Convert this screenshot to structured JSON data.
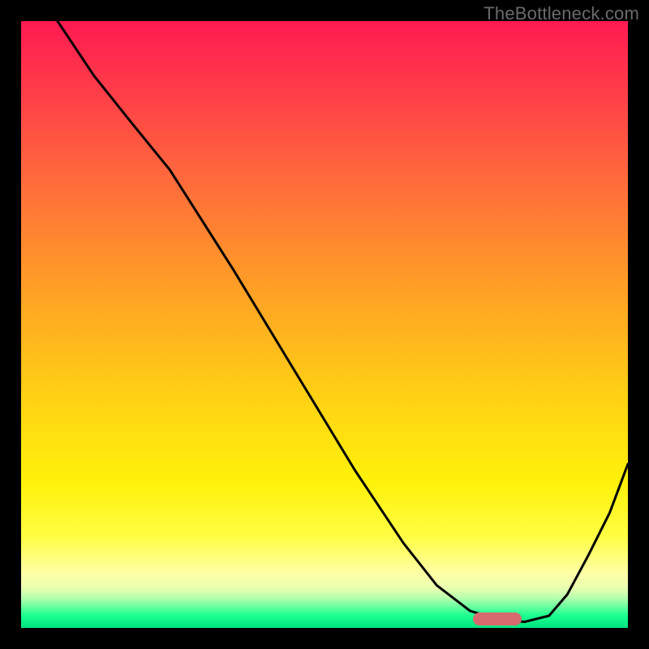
{
  "credit_text": "TheBottleneck.com",
  "chart_data": {
    "type": "line",
    "title": "",
    "xlabel": "",
    "ylabel": "",
    "xlim": [
      0,
      100
    ],
    "ylim": [
      0,
      100
    ],
    "series": [
      {
        "name": "curve",
        "x": [
          6,
          12,
          18,
          24.5,
          35,
          45,
          55,
          63,
          68.5,
          74,
          79,
          83,
          87,
          90,
          93.5,
          97,
          100
        ],
        "values": [
          100,
          91,
          83.5,
          75.5,
          59,
          42.5,
          26,
          14,
          7,
          2.8,
          1.3,
          1.0,
          2.0,
          5.5,
          12,
          19,
          27
        ]
      }
    ],
    "marker": {
      "x_center": 78.5,
      "y": 1.5,
      "width_pct": 8
    },
    "gradient": {
      "direction": "top-to-bottom",
      "stops": [
        {
          "pos": 0.0,
          "color": "#ff1a52"
        },
        {
          "pos": 0.45,
          "color": "#ffa224"
        },
        {
          "pos": 0.76,
          "color": "#fff20a"
        },
        {
          "pos": 0.95,
          "color": "#b8ffae"
        },
        {
          "pos": 1.0,
          "color": "#00e47e"
        }
      ]
    }
  }
}
